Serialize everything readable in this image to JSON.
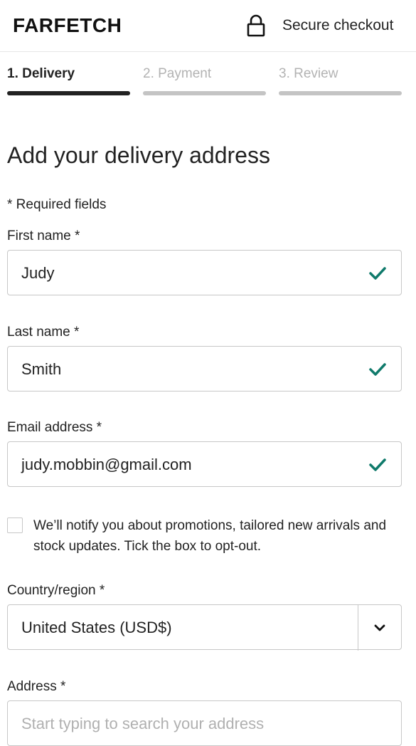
{
  "header": {
    "brand": "FARFETCH",
    "lock_icon": "lock-icon",
    "secure_label": "Secure checkout"
  },
  "steps": [
    {
      "label": "1. Delivery",
      "active": true
    },
    {
      "label": "2. Payment",
      "active": false
    },
    {
      "label": "3. Review",
      "active": false
    }
  ],
  "form": {
    "title": "Add your delivery address",
    "required_note": "* Required fields",
    "first_name": {
      "label": "First name *",
      "value": "Judy",
      "valid": true
    },
    "last_name": {
      "label": "Last name *",
      "value": "Smith",
      "valid": true
    },
    "email": {
      "label": "Email address *",
      "value": "judy.mobbin@gmail.com",
      "valid": true
    },
    "optin_text": "We’ll notify you about promotions, tailored new arrivals and stock updates. Tick the box to opt-out.",
    "country": {
      "label": "Country/region *",
      "value": "United States (USD$)"
    },
    "address": {
      "label": "Address *",
      "placeholder": "Start typing to search your address"
    }
  },
  "colors": {
    "check": "#0f7a6b",
    "active_step": "#222222",
    "inactive_step": "#c4c4c4"
  }
}
